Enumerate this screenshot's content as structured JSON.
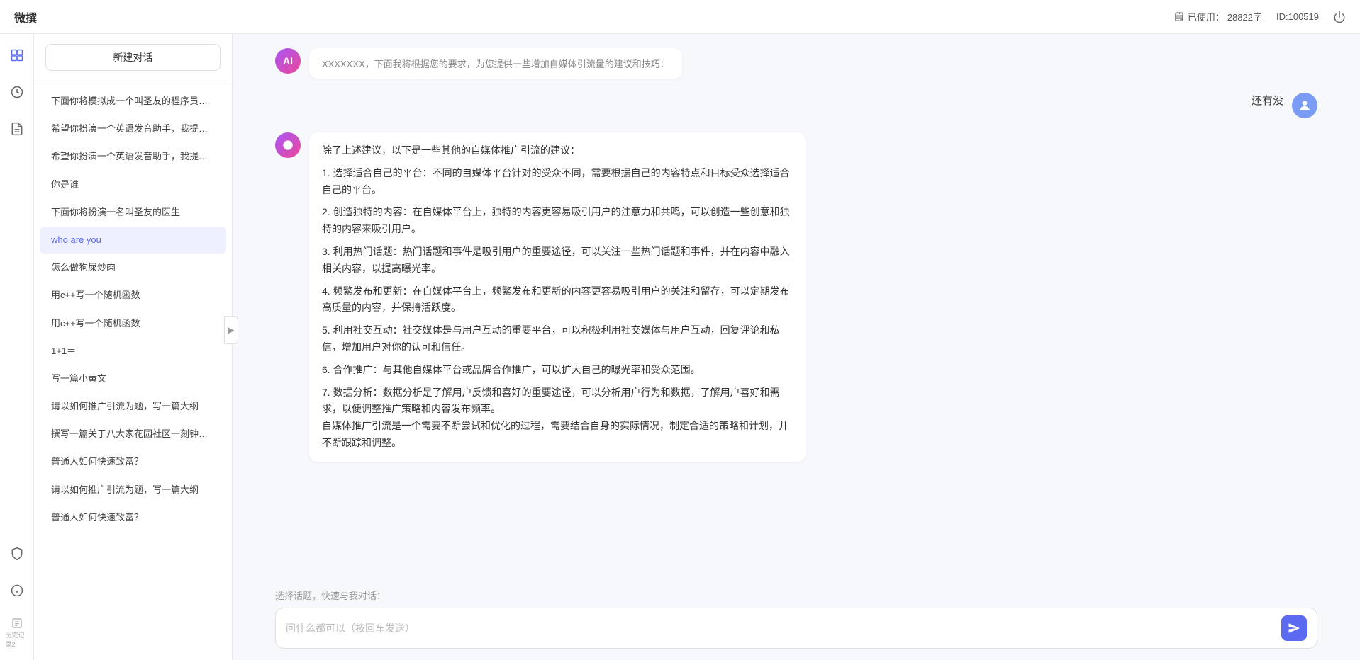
{
  "app": {
    "name": "微撰",
    "usage_label": "已使用：",
    "usage_value": "28822字",
    "id_label": "ID:100519"
  },
  "sidebar": {
    "new_chat": "新建对话",
    "items": [
      {
        "id": "item-1",
        "text": "下面你将模拟成一个叫圣友的程序员，我说..."
      },
      {
        "id": "item-2",
        "text": "希望你扮演一个英语发音助手，我提供给你..."
      },
      {
        "id": "item-3",
        "text": "希望你扮演一个英语发音助手，我提供给你..."
      },
      {
        "id": "item-4",
        "text": "你是谁"
      },
      {
        "id": "item-5",
        "text": "下面你将扮演一名叫圣友的医生"
      },
      {
        "id": "item-6",
        "text": "who are you",
        "active": true
      },
      {
        "id": "item-7",
        "text": "怎么做狗屎炒肉"
      },
      {
        "id": "item-8",
        "text": "用c++写一个随机函数"
      },
      {
        "id": "item-9",
        "text": "用c++写一个随机函数"
      },
      {
        "id": "item-10",
        "text": "1+1＝"
      },
      {
        "id": "item-11",
        "text": "写一篇小黄文"
      },
      {
        "id": "item-12",
        "text": "请以如何推广引流为题，写一篇大纲"
      },
      {
        "id": "item-13",
        "text": "撰写一篇关于八大家花园社区一刻钟便民生..."
      },
      {
        "id": "item-14",
        "text": "普通人如何快速致富？"
      },
      {
        "id": "item-15",
        "text": "请以如何推广引流为题，写一篇大纲"
      },
      {
        "id": "item-16",
        "text": "普通人如何快速致富？"
      }
    ]
  },
  "chat": {
    "partial_top": "XXXXXXX，下面我将根据您的要求，为您提供一些增加自媒体引流量的建议和技巧：",
    "user_message": "还有没",
    "ai_response": {
      "intro": "除了上述建议，以下是一些其他的自媒体推广引流的建议：",
      "points": [
        "1. 选择适合自己的平台：不同的自媒体平台针对的受众不同，需要根据自己的内容特点和目标受众选择适合自己的平台。",
        "2. 创造独特的内容：在自媒体平台上，独特的内容更容易吸引用户的注意力和共鸣，可以创造一些创意和独特的内容来吸引用户。",
        "3. 利用热门话题：热门话题和事件是吸引用户的重要途径，可以关注一些热门话题和事件，并在内容中融入相关内容，以提高曝光率。",
        "4. 频繁发布和更新：在自媒体平台上，频繁发布和更新的内容更容易吸引用户的关注和留存，可以定期发布高质量的内容，并保持活跃度。",
        "5. 利用社交互动：社交媒体是与用户互动的重要平台，可以积极利用社交媒体与用户互动，回复评论和私信，增加用户对你的认可和信任。",
        "6. 合作推广：与其他自媒体平台或品牌合作推广，可以扩大自己的曝光率和受众范围。",
        "7. 数据分析：数据分析是了解用户反馈和喜好的重要途径，可以分析用户行为和数据，了解用户喜好和需求，以便调整推广策略和内容发布频率。"
      ],
      "conclusion": "自媒体推广引流是一个需要不断尝试和优化的过程，需要结合自身的实际情况，制定合适的策略和计划，并不断跟踪和调整。"
    }
  },
  "input": {
    "quick_topic_label": "选择话题，快速与我对话：",
    "placeholder": "问什么都可以（按回车发送）"
  },
  "icons": {
    "logo": "W",
    "usage_icon": "📋",
    "power_icon": "⏻",
    "nav1": "◆",
    "nav2": "⏰",
    "nav3": "📄",
    "collapse": "▶",
    "shield": "🛡",
    "info": "ℹ",
    "bottom_label": "历史记录2"
  }
}
